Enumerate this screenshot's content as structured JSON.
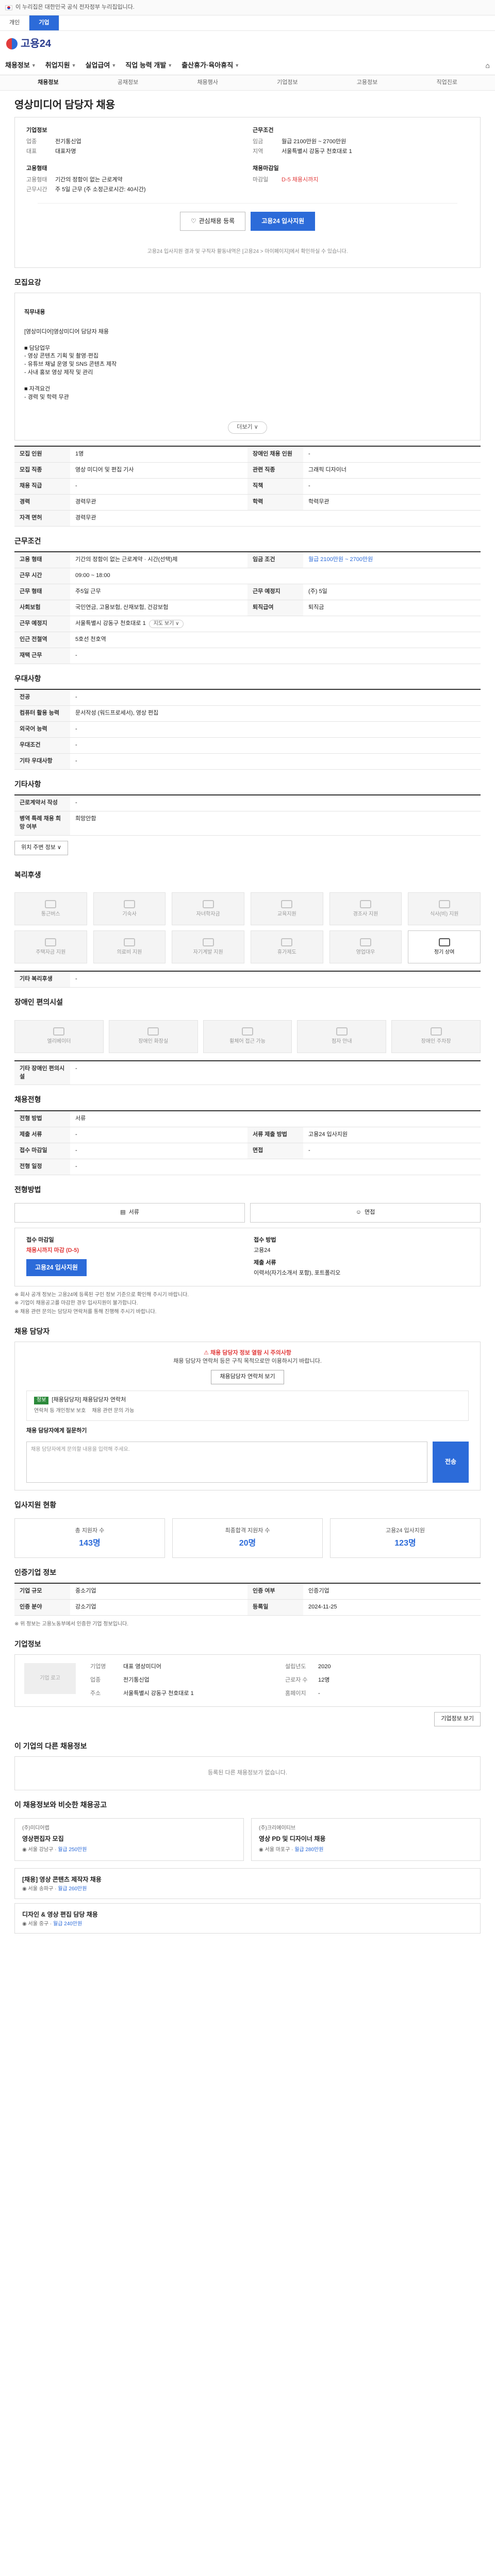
{
  "topbar": {
    "notice": "이 누리집은 대한민국 공식 전자정부 누리집입니다."
  },
  "subbar": {
    "tabs": [
      "개인",
      "기업"
    ]
  },
  "logo": {
    "text": "고용24"
  },
  "gnb": {
    "items": [
      "채용정보",
      "취업지원",
      "실업급여",
      "직업 능력 개발",
      "출산휴가·육아휴직"
    ],
    "home": "⌂"
  },
  "lnb": {
    "items": [
      "채용정보",
      "공채정보",
      "채용행사",
      "기업정보",
      "고용정보",
      "직업진로"
    ]
  },
  "job": {
    "title": "영상미디어 담당자 채용",
    "company_label": "기업정보",
    "company_rows": [
      {
        "k": "업종",
        "v": "전기통신업"
      },
      {
        "k": "대표",
        "v": "대표자명"
      }
    ],
    "cond_label": "근무조건",
    "cond_rows": [
      {
        "k": "임금",
        "v": "월급 2100만원 ~ 2700만원"
      },
      {
        "k": "지역",
        "v": "서울특별시 강동구 천호대로 1"
      }
    ],
    "apply_label": "고용형태",
    "apply_rows": [
      {
        "k": "고용형태",
        "v": "기간의 정함이 없는 근로계약"
      },
      {
        "k": "근무시간",
        "v": "주 5일 근무 (주 소정근로시간: 40시간)"
      }
    ],
    "deadline_label": "채용마감일",
    "deadline_rows": [
      {
        "k": "마감일",
        "v": "D-5 채용시까지"
      }
    ],
    "save_label": "관심채용 등록",
    "apply_label_btn": "고용24 입사지원",
    "note": "고용24 입사지원 결과 및 구직자 활동내역은 [고용24 > 마이페이지]에서 확인하실 수 있습니다."
  },
  "desc": {
    "title": "모집요강",
    "label": "직무내용",
    "body": "[영상미디어]영상미디어 담당자 채용\n\n■ 담당업무\n - 영상 콘텐츠 기획 및 촬영·편집\n - 유튜브 채널 운영 및 SNS 콘텐츠 제작\n - 사내 홍보 영상 제작 및 관리\n\n■ 자격요건\n - 경력 및 학력 무관",
    "expand": "더보기 ∨"
  },
  "summary": {
    "rows": [
      {
        "k": "모집 인원",
        "v": "1명",
        "k2": "장애인 채용 인원",
        "v2": "-"
      },
      {
        "k": "모집 직종",
        "v": "영상 미디어 및 편집 기사",
        "k2": "관련 직종",
        "v2": "그래픽 디자이너"
      },
      {
        "k": "채용 직급",
        "v": "-",
        "k2": "직책",
        "v2": "-"
      },
      {
        "k": "경력",
        "v": "경력무관",
        "k2": "학력",
        "v2": "학력무관"
      },
      {
        "k": "자격 면허",
        "v": "경력무관",
        "k2": "",
        "v2": ""
      }
    ]
  },
  "work": {
    "title": "근무조건",
    "rows": [
      {
        "k": "고용 형태",
        "v": "기간의 정함이 없는 근로계약 · 시간(선택)제",
        "k2": "임금 조건",
        "v2": "월급 2100만원 ~ 2700만원"
      },
      {
        "k": "근무 시간",
        "v": "09:00 ~ 18:00",
        "k2": "",
        "v2": ""
      },
      {
        "k": "근무 형태",
        "v": "주5일 근무",
        "k2": "근무 예정지",
        "v2": "(주) 5일"
      },
      {
        "k": "사회보험",
        "v": "국민연금, 고용보험, 산재보험, 건강보험",
        "k2": "퇴직급여",
        "v2": "퇴직금"
      },
      {
        "k": "근무 예정지",
        "v": "서울특별시 강동구 천호대로 1",
        "k2": "",
        "v2": ""
      },
      {
        "k": "인근 전철역",
        "v": "5호선 천호역 ",
        "k2": "",
        "v2": ""
      },
      {
        "k": "재택 근무",
        "v": "-",
        "k2": "",
        "v2": ""
      }
    ],
    "map_btn": "지도 보기 ∨"
  },
  "pref": {
    "title": "우대사항",
    "rows": [
      {
        "k": "전공",
        "v": "-"
      },
      {
        "k": "컴퓨터 활용 능력",
        "v": "문서작성 (워드프로세서), 영상 편집"
      },
      {
        "k": "외국어 능력",
        "v": "-"
      },
      {
        "k": "우대조건",
        "v": "-"
      },
      {
        "k": "기타 우대사항",
        "v": "-"
      }
    ]
  },
  "etc": {
    "title": "기타사항",
    "rows": [
      {
        "k": "근로계약서 작성",
        "v": "-"
      },
      {
        "k": "병역 특례 채용 희망 여부",
        "v": "희망안함"
      }
    ],
    "btn": "위치 주변 정보 ∨"
  },
  "benefit": {
    "title": "복리후생",
    "items": [
      "통근버스",
      "기숙사",
      "자녀학자금",
      "교육지원",
      "경조사 지원",
      "식사(비) 지원",
      "주택자금 지원",
      "의료비 지원",
      "자기계발 지원",
      "휴가제도",
      "영업대우",
      "정기 상여"
    ],
    "active": [
      11
    ],
    "note_label": "기타 복리후생",
    "note": "-"
  },
  "disabled": {
    "title": "장애인 편의시설",
    "items": [
      "엘리베이터",
      "장애인 화장실",
      "휠체어 접근 가능",
      "점자 안내",
      "장애인 주차장"
    ],
    "note_label": "기타 장애인 편의시설",
    "note": "-"
  },
  "hire": {
    "title": "채용전형",
    "rows": [
      {
        "k": "전형 방법",
        "v": "서류",
        "k2": "",
        "v2": ""
      },
      {
        "k": "제출 서류",
        "v": "-",
        "k2": "서류 제출 방법",
        "v2": "고용24 입사지원"
      },
      {
        "k": "접수 마감일",
        "v": "-",
        "k2": "면접",
        "v2": "-"
      },
      {
        "k": "전형 일정",
        "v": "-",
        "k2": "",
        "v2": ""
      }
    ]
  },
  "method": {
    "title": "전형방법",
    "btns": [
      "서류",
      "면접"
    ]
  },
  "apply": {
    "deadline_label": "접수 마감일",
    "deadline": "채용시까지 마감 (D-5)",
    "method_label": "접수 방법",
    "method": "고용24",
    "btn": "고용24 입사지원",
    "doc_label": "제출 서류",
    "doc": "이력서(자기소개서 포함), 포트폴리오",
    "bullets": [
      "※ 회사 공개 정보는 고용24에 등록된 구인 정보 기준으로 확인해 주시기 바랍니다.",
      "※ 기업이 채용공고를 마감한 경우 입사지원이 불가합니다.",
      "※ 채용 관련 문의는 담당자 연락처를 통해 진행해 주시기 바랍니다."
    ]
  },
  "agent": {
    "title": "채용 담당자",
    "warn": "채용 담당자 정보 열람 시 주의사항",
    "desc": "채용 담당자 연락처 등은 구직 목적으로만 이용하시기 바랍니다.",
    "btn": "채용담당자 연락처 보기",
    "badge": "정보",
    "row_title": "[채용담당자] 채용담당자 연락처",
    "sub": [
      "연락처 등 개인정보 보호",
      "채용 관련 문의 가능"
    ],
    "msg_label": "채용 담당자에게 질문하기",
    "msg_placeholder": "채용 담당자에게 문의할 내용을 입력해 주세요.",
    "msg_btn": "전송"
  },
  "stats": {
    "title": "입사지원 현황",
    "items": [
      {
        "k": "총 지원자 수",
        "v": "143명"
      },
      {
        "k": "최종합격 지원자 수",
        "v": "20명"
      },
      {
        "k": "고용24 입사지원",
        "v": "123명"
      }
    ]
  },
  "manage": {
    "title": "인증기업 정보",
    "rows": [
      {
        "k": "기업 규모",
        "v": "중소기업",
        "k2": "인증 여부",
        "v2": "인증기업"
      },
      {
        "k": "인증 분야",
        "v": "강소기업",
        "k2": "등록일",
        "v2": "2024-11-25"
      }
    ],
    "note": "※ 위 정보는 고용노동부에서 인증한 기업 정보입니다."
  },
  "company": {
    "title": "기업정보",
    "logo": "기업 로고",
    "rows": [
      {
        "k": "기업명",
        "v": "대표 영상미디어"
      },
      {
        "k": "업종",
        "v": "전기통신업"
      },
      {
        "k": "주소",
        "v": "서울특별시 강동구 천호대로 1"
      }
    ],
    "rows2": [
      {
        "k": "설립년도",
        "v": "2020"
      },
      {
        "k": "근로자 수",
        "v": "12명"
      },
      {
        "k": "홈페이지",
        "v": "-"
      }
    ],
    "btn": "기업정보 보기"
  },
  "other": {
    "title": "이 기업의 다른 채용정보",
    "empty": "등록된 다른 채용정보가 없습니다."
  },
  "recommend": {
    "title": "이 채용정보와 비슷한 채용공고",
    "items": [
      {
        "co": "(주)미디어랩",
        "ti": "영상편집자 모집",
        "meta": "서울 강남구",
        "pay": "월급 250만원"
      },
      {
        "co": "(주)크리에이티브",
        "ti": "영상 PD 및 디자이너 채용",
        "meta": "서울 마포구",
        "pay": "월급 280만원"
      }
    ],
    "ad_title": "[채용] 영상 콘텐츠 제작자 채용",
    "ad_meta": "서울 송파구",
    "ad_pay": "월급 260만원",
    "ad2_title": "디자인 & 영상 편집 담당 채용",
    "ad2_meta": "서울 중구",
    "ad2_pay": "월급 240만원"
  }
}
